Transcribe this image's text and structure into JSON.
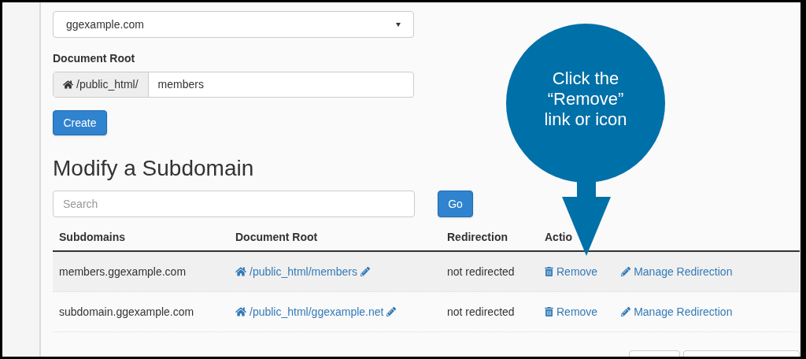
{
  "create_form": {
    "domain_select": {
      "value": "ggexample.com"
    },
    "document_root": {
      "label": "Document Root",
      "prefix": "/public_html/",
      "value": "members"
    },
    "create_button": "Create"
  },
  "modify": {
    "heading": "Modify a Subdomain",
    "search": {
      "placeholder": "Search"
    },
    "go_button": "Go"
  },
  "table": {
    "columns": [
      "Subdomains",
      "Document Root",
      "Redirection",
      "Actio"
    ],
    "rows": [
      {
        "subdomain": "members.ggexample.com",
        "document_root": "/public_html/members",
        "redirection": "not redirected",
        "remove": "Remove",
        "manage": "Manage Redirection"
      },
      {
        "subdomain": "subdomain.ggexample.com",
        "document_root": "/public_html/ggexample.net",
        "redirection": "not redirected",
        "remove": "Remove",
        "manage": "Manage Redirection"
      }
    ]
  },
  "callout": {
    "text": "Click the “Remove” link or icon"
  }
}
